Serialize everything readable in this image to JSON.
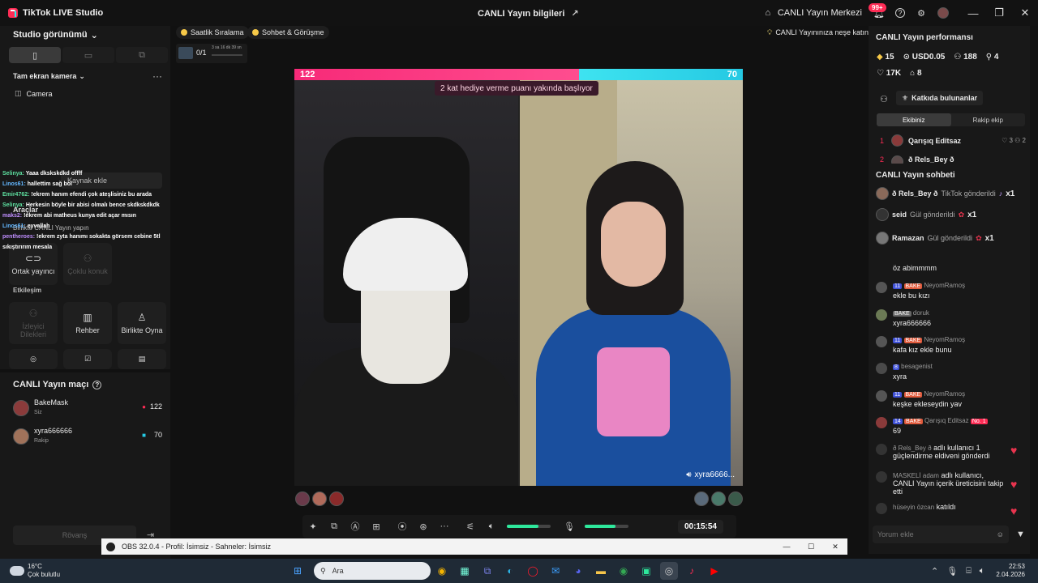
{
  "titlebar": {
    "app_title": "TikTok LIVE Studio",
    "center_title": "CANLI Yayın bilgileri",
    "live_center": "CANLI Yayın Merkezi",
    "notif_badge": "99+"
  },
  "left": {
    "studio_view": "Studio görünümü",
    "fullscreen_camera": "Tam ekran kamera",
    "camera_source": "Camera",
    "tools_label": "Araçlar",
    "tools_sub": "Birlikte CANLI Yayın yapın",
    "source_add": "Kaynak ekle",
    "grid_buttons": {
      "co_host": "Ortak yayıncı",
      "multi_guest": "Çoklu konuk",
      "viewer_wishes": "İzleyici Dilekleri",
      "guide": "Rehber",
      "play_together": "Birlikte Oyna"
    },
    "interaction_label": "Etkileşim",
    "overlay_chat": [
      {
        "user": "Selinya:",
        "text": "Yaaa dkskskdkd offff"
      },
      {
        "user": "Linos61:",
        "text": "hallettim sağ bol"
      },
      {
        "user": "Emir4762:",
        "text": "!ekrem hanım efendi çok ateşlisiniz bu arada"
      },
      {
        "user": "Selinya:",
        "text": "Herkesin böyle bir abisi olmalı bence skdkskdkdk"
      },
      {
        "user": "maks2:",
        "text": "!ekrem abi matheus kunya edit açar mısın"
      },
      {
        "user": "Linos61:",
        "text": "eyvallah"
      },
      {
        "user": "pentheroes:",
        "text": "!ekrem zyta hanımı sokakta görsem cebine 5tl sıkıştırırım mesala"
      }
    ]
  },
  "match": {
    "title": "CANLI Yayın maçı",
    "player1_name": "BakeMask",
    "player1_sub": "Siz",
    "player1_score": "122",
    "player2_name": "xyra666666",
    "player2_sub": "Rakip",
    "player2_score": "70",
    "rematch": "Rövanş"
  },
  "center": {
    "pill_hourly": "Saatlik Sıralama",
    "pill_chat": "Sohbet & Görüşme",
    "pill_joy": "CANLI Yayınınıza neşe katın",
    "goal_count": "0/1",
    "goal_time": "3 sa 16 dk 39 sn",
    "score_left": "122",
    "score_right": "70",
    "score_ratio": 0.635,
    "banner": "2 kat hediye verme puanı yakında başlıyor",
    "right_cam_label": "xyra6666...",
    "timer": "00:15:54",
    "volume_level": 0.72,
    "mic_level": 0.7
  },
  "right": {
    "performance_title": "CANLI Yayın performansı",
    "diamonds": "15",
    "usd": "USD0.05",
    "viewers": "188",
    "new_followers": "4",
    "likes": "17K",
    "gifts": "8",
    "contributors": "Katkıda bulunanlar",
    "tab_team": "Ekibiniz",
    "tab_rival": "Rakip ekip",
    "rank1_num": "1",
    "rank1_name": "Qarışıq Editsaz",
    "rank1_stat_a": "3",
    "rank1_stat_b": "2",
    "rank2_num": "2",
    "rank2_name": "ð Rels_Bey ð",
    "chat_title": "CANLI Yayın sohbeti",
    "gifts_list": [
      {
        "user": "ð Rels_Bey ð",
        "text": "TikTok gönderildi",
        "count": "x1"
      },
      {
        "user": "seid",
        "text": "Gül gönderildi",
        "count": "x1"
      },
      {
        "user": "Ramazan",
        "text": "Gül gönderildi",
        "count": "x1"
      }
    ],
    "messages": [
      {
        "meta": "",
        "text": "öz abimmmm"
      },
      {
        "meta": "NeyomRamoş",
        "lvl": "11",
        "badge": "BAKE",
        "text": "ekle bu kızı"
      },
      {
        "meta": "doruk",
        "badge": "BAKE",
        "text": "xyra666666"
      },
      {
        "meta": "NeyomRamoş",
        "lvl": "11",
        "badge": "BAKE",
        "text": "kafa kız ekle bunu"
      },
      {
        "meta": "besagenist",
        "lvl": "8",
        "text": "xyra"
      },
      {
        "meta": "NeyomRamoş",
        "lvl": "11",
        "badge": "BAKE",
        "text": "keşke ekleseydin yav"
      },
      {
        "meta": "Qarışıq Editsaz",
        "lvl": "14",
        "badge": "BAKE",
        "extra": "No. 1",
        "text": "69"
      }
    ],
    "sys_1a": "ð Rels_Bey ð",
    "sys_1b": "adlı kullanıcı 1 güçlendirme eldiveni gönderdi",
    "sys_2a": "MASKELİ adam",
    "sys_2b": "adlı kullanıcı, CANLI Yayın içerik üreticisini takip etti",
    "sys_3a": "hüseyin özcan",
    "sys_3b": "katıldı",
    "comment_placeholder": "Yorum ekle"
  },
  "obs": {
    "title": "OBS 32.0.4 - Profil: İsimsiz - Sahneler: İsimsiz"
  },
  "taskbar": {
    "temp": "16°C",
    "weather": "Çok bulutlu",
    "search": "Ara",
    "time": "22:53",
    "date": "2.04.2026"
  },
  "colors": {
    "accent_pink": "#fe2c55",
    "accent_cyan": "#25f4ee",
    "green": "#2ee89c"
  }
}
